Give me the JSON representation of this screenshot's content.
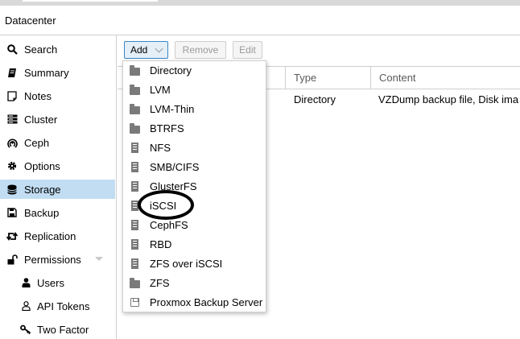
{
  "header": {
    "title": "Datacenter"
  },
  "sidebar": {
    "items": [
      {
        "label": "Search",
        "icon": "search-icon"
      },
      {
        "label": "Summary",
        "icon": "book-icon"
      },
      {
        "label": "Notes",
        "icon": "note-icon"
      },
      {
        "label": "Cluster",
        "icon": "server-icon"
      },
      {
        "label": "Ceph",
        "icon": "ceph-icon"
      },
      {
        "label": "Options",
        "icon": "gear-icon"
      },
      {
        "label": "Storage",
        "icon": "database-icon",
        "selected": true
      },
      {
        "label": "Backup",
        "icon": "floppy-icon"
      },
      {
        "label": "Replication",
        "icon": "retweet-icon"
      },
      {
        "label": "Permissions",
        "icon": "unlock-icon"
      },
      {
        "label": "Users",
        "icon": "user-icon"
      },
      {
        "label": "API Tokens",
        "icon": "user-outline-icon"
      },
      {
        "label": "Two Factor",
        "icon": "key-icon"
      }
    ]
  },
  "toolbar": {
    "add_label": "Add",
    "remove_label": "Remove",
    "edit_label": "Edit"
  },
  "grid": {
    "columns": [
      "Type",
      "Content"
    ],
    "rows": [
      {
        "type": "Directory",
        "content": "VZDump backup file, Disk ima"
      }
    ]
  },
  "add_menu": {
    "items": [
      {
        "label": "Directory",
        "icon": "folder-icon"
      },
      {
        "label": "LVM",
        "icon": "folder-icon"
      },
      {
        "label": "LVM-Thin",
        "icon": "folder-icon"
      },
      {
        "label": "BTRFS",
        "icon": "folder-icon"
      },
      {
        "label": "NFS",
        "icon": "building-icon"
      },
      {
        "label": "SMB/CIFS",
        "icon": "building-icon"
      },
      {
        "label": "GlusterFS",
        "icon": "building-icon"
      },
      {
        "label": "iSCSI",
        "icon": "building-icon"
      },
      {
        "label": "CephFS",
        "icon": "building-icon"
      },
      {
        "label": "RBD",
        "icon": "building-icon"
      },
      {
        "label": "ZFS over iSCSI",
        "icon": "building-icon"
      },
      {
        "label": "ZFS",
        "icon": "folder-icon"
      },
      {
        "label": "Proxmox Backup Server",
        "icon": "floppy-icon"
      }
    ]
  },
  "colors": {
    "selected_bg": "#c2ddf2",
    "accent": "#3a87c7",
    "icon_gray": "#7a7a7a"
  }
}
